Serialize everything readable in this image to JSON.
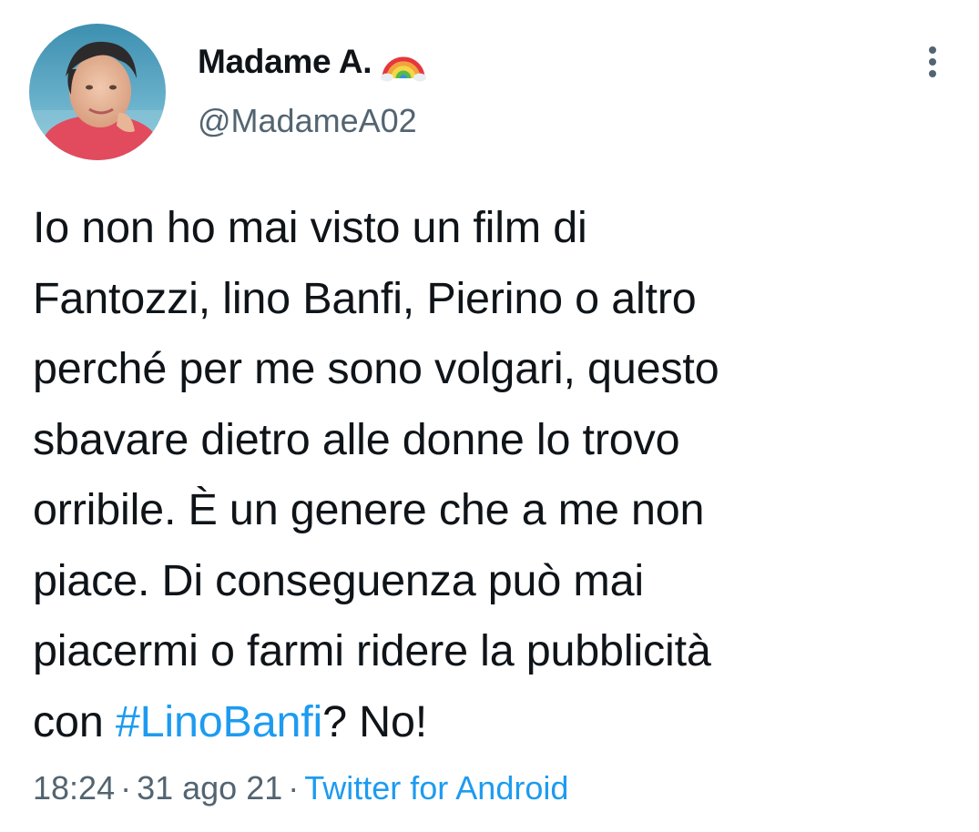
{
  "author": {
    "display_name": "Madame A.",
    "emoji_icon": "rainbow-icon",
    "handle": "@MadameA02"
  },
  "tweet": {
    "lines": [
      "Io non ho mai visto un film di",
      "Fantozzi, lino Banfi, Pierino o altro",
      "perché per me sono volgari, questo",
      "sbavare dietro alle donne lo trovo",
      "orribile. È un genere che a me non",
      "piace. Di conseguenza può mai",
      "piacermi o farmi ridere la pubblicità"
    ],
    "last_line_prefix": "con ",
    "hashtag": "#LinoBanfi",
    "last_line_suffix": "? No!"
  },
  "meta": {
    "time": "18:24",
    "separator": "·",
    "date": "31 ago 21",
    "source": "Twitter for Android"
  },
  "colors": {
    "text": "#0f1419",
    "secondary": "#536471",
    "link": "#1d9bf0"
  },
  "icons": {
    "more": "more-vertical-icon"
  }
}
